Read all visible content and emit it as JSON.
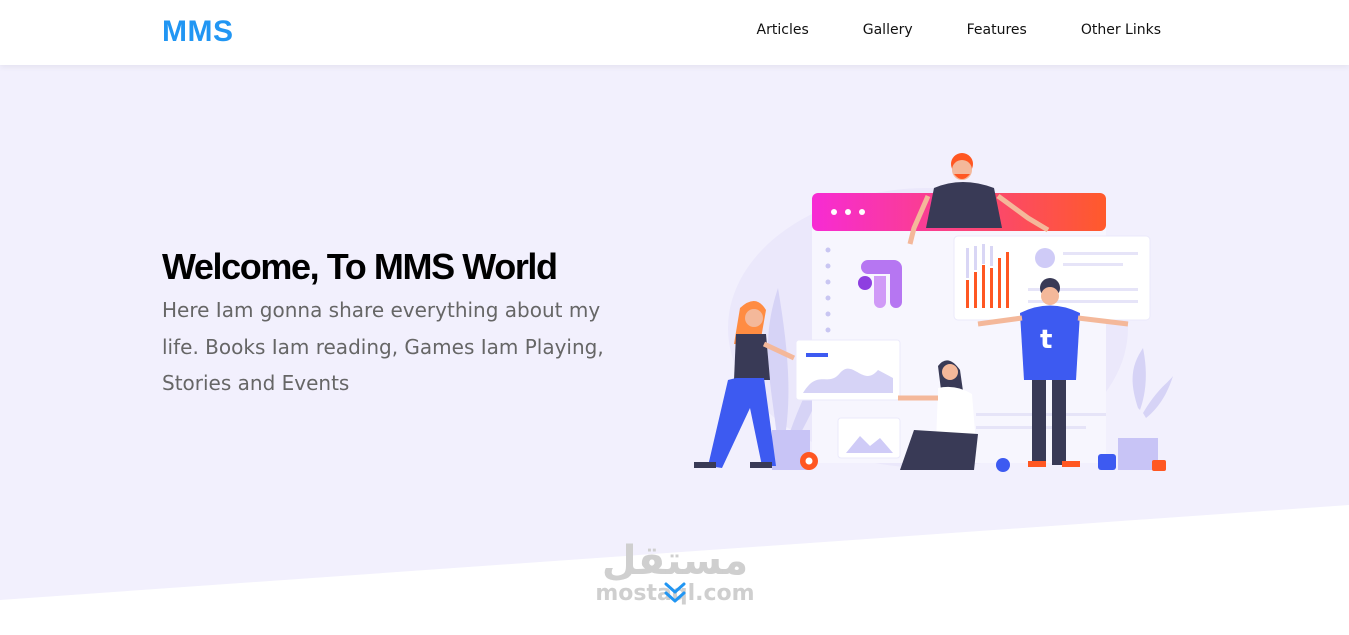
{
  "header": {
    "logo": "MMS",
    "nav": [
      "Articles",
      "Gallery",
      "Features",
      "Other Links"
    ]
  },
  "hero": {
    "title": "Welcome, To MMS World",
    "text": "Here Iam gonna share everything about my life. Books Iam reading, Games Iam Playing, Stories and Events"
  },
  "watermark": {
    "arabic": "مستقل",
    "latin": "mostaql.com"
  },
  "colors": {
    "brand": "#2196f3",
    "hero_bg": "#f2f0fd"
  },
  "icons": {
    "scroll": "double-chevron-down-icon"
  }
}
